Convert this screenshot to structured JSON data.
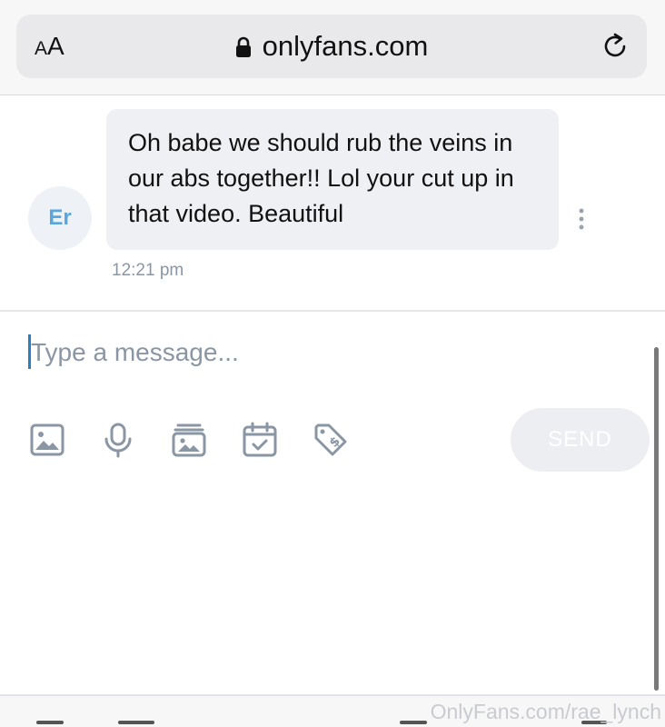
{
  "browser": {
    "text_size_label": "AA",
    "url": "onlyfans.com",
    "icons": {
      "lock": "lock-icon",
      "reload": "reload-icon"
    }
  },
  "message": {
    "avatar_initials": "Er",
    "text": "Oh babe we should rub the veins in our abs together!! Lol your cut up in that video. Beautiful",
    "time": "12:21 pm",
    "options_icon": "more-vertical-icon"
  },
  "composer": {
    "placeholder": "Type a message...",
    "value": "",
    "tools": [
      "image-icon",
      "microphone-icon",
      "media-vault-icon",
      "calendar-check-icon",
      "price-tag-icon"
    ],
    "send_label": "SEND"
  },
  "watermark": "OnlyFans.com/rae_lynch",
  "colors": {
    "accent": "#55a7dd",
    "bubble": "#eef0f3",
    "muted_text": "#8a96a3",
    "icon": "#8a96a3",
    "send_button": "#eceef1"
  }
}
